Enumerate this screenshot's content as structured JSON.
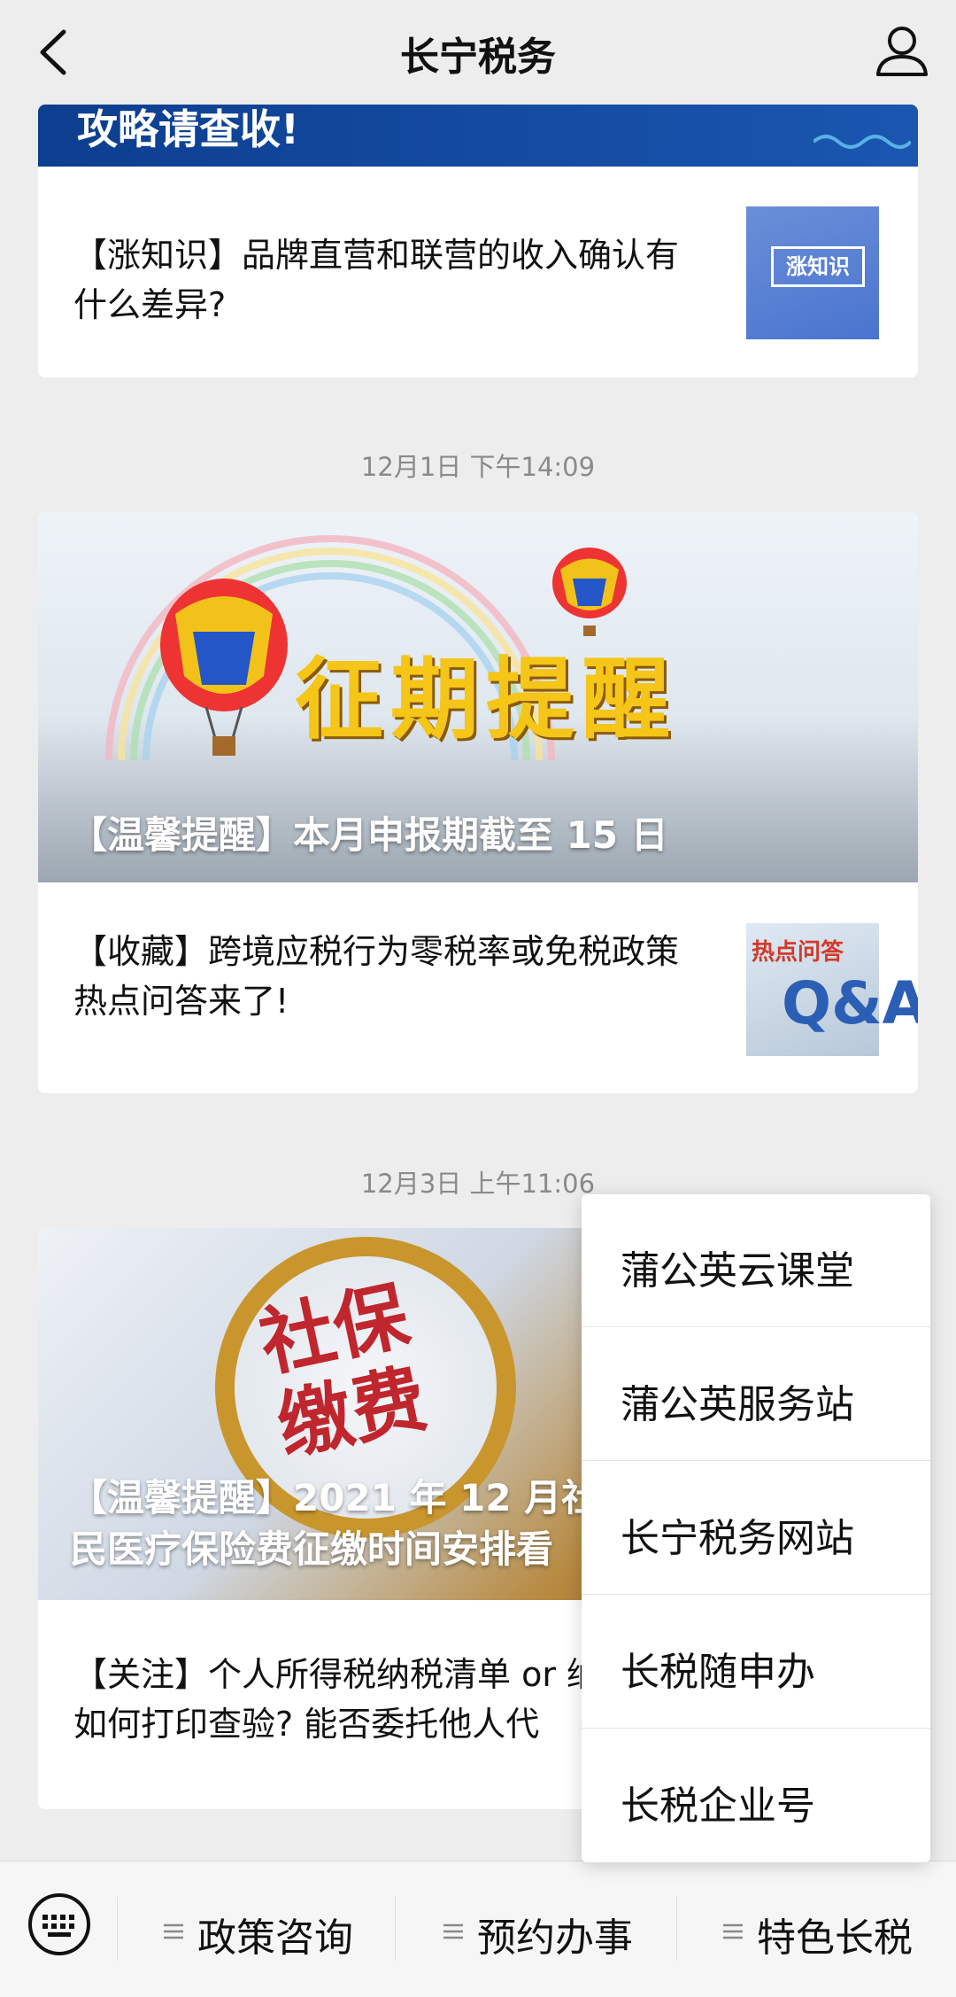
{
  "header": {
    "title": "长宁税务"
  },
  "top_banner": {
    "text": "攻略请查收!"
  },
  "articles": [
    {
      "text": "【涨知识】品牌直营和联营的收入确认有什么差异?",
      "thumb_label": "涨知识"
    },
    {
      "time": "12月1日 下午14:09",
      "cover_art_text": "征期提醒",
      "cover_caption": "【温馨提醒】本月申报期截至 15 日"
    },
    {
      "text": "【收藏】跨境应税行为零税率或免税政策热点问答来了!",
      "thumb_label": "热点问答"
    },
    {
      "time": "12月3日 上午11:06",
      "cover_art_text": "社保缴费",
      "cover_caption": "【温馨提醒】2021 年 12 月社会 \n民医疗保险费征缴时间安排看"
    },
    {
      "text": "【关注】个人所得税纳税清单 or 纳\n如何打印查验? 能否委托他人代"
    }
  ],
  "menu": {
    "items": [
      "蒲公英云课堂",
      "蒲公英服务站",
      "长宁税务网站",
      "长税随申办",
      "长税企业号"
    ],
    "highlight_color": "#d9141a"
  },
  "bottom_bar": {
    "tabs": [
      "政策咨询",
      "预约办事",
      "特色长税"
    ]
  }
}
